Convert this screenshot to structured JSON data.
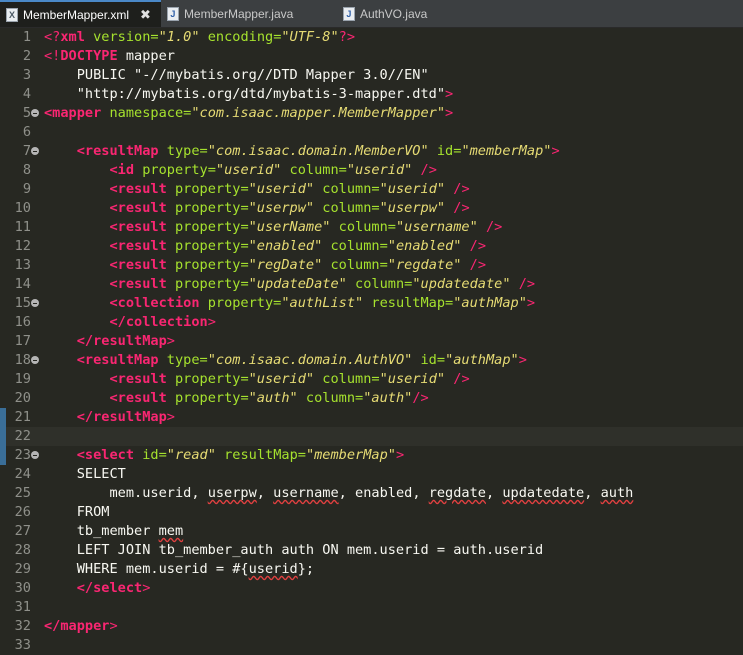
{
  "tabs": [
    {
      "label": "MemberMapper.xml",
      "icon": "xml-file-icon",
      "active": true,
      "close": "✖"
    },
    {
      "label": "MemberMapper.java",
      "icon": "java-file-icon",
      "active": false
    },
    {
      "label": "AuthVO.java",
      "icon": "java-file-icon",
      "active": false
    }
  ],
  "colors": {
    "background": "#272822",
    "tag": "#f92672",
    "attribute": "#a6e22e",
    "value": "#e6db74",
    "text": "#f8f8f2",
    "line_number": "#8f908a"
  },
  "lines": [
    {
      "n": "1"
    },
    {
      "n": "2"
    },
    {
      "n": "3"
    },
    {
      "n": "4"
    },
    {
      "n": "5"
    },
    {
      "n": "6"
    },
    {
      "n": "7"
    },
    {
      "n": "8"
    },
    {
      "n": "9"
    },
    {
      "n": "10"
    },
    {
      "n": "11"
    },
    {
      "n": "12"
    },
    {
      "n": "13"
    },
    {
      "n": "14"
    },
    {
      "n": "15"
    },
    {
      "n": "16"
    },
    {
      "n": "17"
    },
    {
      "n": "18"
    },
    {
      "n": "19"
    },
    {
      "n": "20"
    },
    {
      "n": "21"
    },
    {
      "n": "22"
    },
    {
      "n": "23"
    },
    {
      "n": "24"
    },
    {
      "n": "25"
    },
    {
      "n": "26"
    },
    {
      "n": "27"
    },
    {
      "n": "28"
    },
    {
      "n": "29"
    },
    {
      "n": "30"
    },
    {
      "n": "31"
    },
    {
      "n": "32"
    },
    {
      "n": "33"
    }
  ],
  "code": {
    "l1": {
      "pi_open": "<?",
      "kw": "xml",
      "attr1": " version=",
      "val1": "\"1.0\"",
      "attr2": " encoding=",
      "val2": "\"UTF-8\"",
      "pi_close": "?>"
    },
    "l2": {
      "open": "<!",
      "kw": "DOCTYPE",
      "rest": " mapper"
    },
    "l3": {
      "text": "    PUBLIC \"-//mybatis.org//DTD Mapper 3.0//EN\""
    },
    "l4": {
      "text": "    \"http://mybatis.org/dtd/mybatis-3-mapper.dtd\"",
      "close": ">"
    },
    "l5": {
      "tag": "<mapper",
      "attr": " namespace=",
      "val": "\"com.isaac.mapper.MemberMapper\"",
      "close": ">"
    },
    "l7": {
      "indent": "    ",
      "tag": "<resultMap",
      "attr1": " type=",
      "val1": "\"com.isaac.domain.MemberVO\"",
      "attr2": " id=",
      "val2": "\"memberMap\"",
      "close": ">"
    },
    "l8": {
      "indent": "        ",
      "tag": "<id",
      "attr1": " property=",
      "val1": "\"userid\"",
      "attr2": " column=",
      "val2": "\"userid\"",
      "close": " />"
    },
    "l9": {
      "indent": "        ",
      "tag": "<result",
      "attr1": " property=",
      "val1": "\"userid\"",
      "attr2": " column=",
      "val2": "\"userid\"",
      "close": " />"
    },
    "l10": {
      "indent": "        ",
      "tag": "<result",
      "attr1": " property=",
      "val1": "\"userpw\"",
      "attr2": " column=",
      "val2": "\"userpw\"",
      "close": " />"
    },
    "l11": {
      "indent": "        ",
      "tag": "<result",
      "attr1": " property=",
      "val1": "\"userName\"",
      "attr2": " column=",
      "val2": "\"username\"",
      "close": " />"
    },
    "l12": {
      "indent": "        ",
      "tag": "<result",
      "attr1": " property=",
      "val1": "\"enabled\"",
      "attr2": " column=",
      "val2": "\"enabled\"",
      "close": " />"
    },
    "l13": {
      "indent": "        ",
      "tag": "<result",
      "attr1": " property=",
      "val1": "\"regDate\"",
      "attr2": " column=",
      "val2": "\"regdate\"",
      "close": " />"
    },
    "l14": {
      "indent": "        ",
      "tag": "<result",
      "attr1": " property=",
      "val1": "\"updateDate\"",
      "attr2": " column=",
      "val2": "\"updatedate\"",
      "close": " />"
    },
    "l15": {
      "indent": "        ",
      "tag": "<collection",
      "attr1": " property=",
      "val1": "\"authList\"",
      "attr2": " resultMap=",
      "val2": "\"authMap\"",
      "close": ">"
    },
    "l16": {
      "indent": "        ",
      "tag": "</collection",
      "close": ">"
    },
    "l17": {
      "indent": "    ",
      "tag": "</resultMap",
      "close": ">"
    },
    "l18": {
      "indent": "    ",
      "tag": "<resultMap",
      "attr1": " type=",
      "val1": "\"com.isaac.domain.AuthVO\"",
      "attr2": " id=",
      "val2": "\"authMap\"",
      "close": ">"
    },
    "l19": {
      "indent": "        ",
      "tag": "<result",
      "attr1": " property=",
      "val1": "\"userid\"",
      "attr2": " column=",
      "val2": "\"userid\"",
      "close": " />"
    },
    "l20": {
      "indent": "        ",
      "tag": "<result",
      "attr1": " property=",
      "val1": "\"auth\"",
      "attr2": " column=",
      "val2": "\"auth\"",
      "close": "/>"
    },
    "l21": {
      "indent": "    ",
      "tag": "</resultMap",
      "close": ">"
    },
    "l23": {
      "indent": "    ",
      "tag": "<select",
      "attr1": " id=",
      "val1": "\"read\"",
      "attr2": " resultMap=",
      "val2": "\"memberMap\"",
      "close": ">"
    },
    "l24": {
      "text": "    SELECT"
    },
    "l25": {
      "a": "        mem.userid, ",
      "b": "userpw",
      "c": ", ",
      "d": "username",
      "e": ", enabled, ",
      "f": "regdate",
      "g": ", ",
      "h": "updatedate",
      "i": ", ",
      "j": "auth"
    },
    "l26": {
      "text": "    FROM"
    },
    "l27": {
      "a": "    tb_member ",
      "b": "mem"
    },
    "l28": {
      "text": "    LEFT JOIN tb_member_auth auth ON mem.userid = auth.userid"
    },
    "l29": {
      "a": "    WHERE mem.userid = #{",
      "b": "userid",
      "c": "};"
    },
    "l30": {
      "indent": "    ",
      "tag": "</select",
      "close": ">"
    },
    "l32": {
      "tag": "</mapper",
      "close": ">"
    }
  }
}
